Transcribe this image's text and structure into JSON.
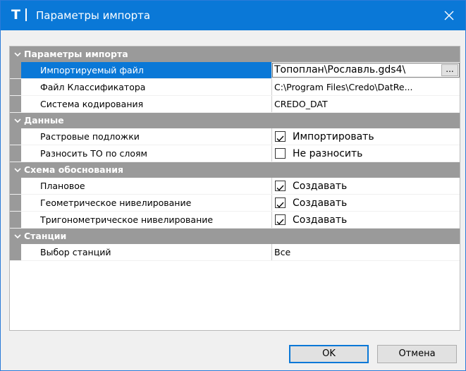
{
  "window": {
    "title": "Параметры импорта",
    "app_icon_letter": "T",
    "close_glyph": "✕"
  },
  "colors": {
    "titlebar": "#0a78d7",
    "category_bg": "#9a9a9a",
    "selection": "#0a78d7"
  },
  "grid": {
    "categories": [
      {
        "label": "Параметры импорта",
        "rows": [
          {
            "name": "Импортируемый файл",
            "value": "\\Топоплан\\Рославль.gds4",
            "selected": true,
            "browse": "..."
          },
          {
            "name": "Файл Классификатора",
            "value": "C:\\Program Files\\Credo\\DatRe..."
          },
          {
            "name": "Система кодирования",
            "value": "CREDO_DAT"
          }
        ]
      },
      {
        "label": "Данные",
        "rows": [
          {
            "name": "Растровые подложки",
            "value": "Импортировать",
            "checked": true
          },
          {
            "name": "Разносить ТО по слоям",
            "value": "Не разносить",
            "checked": false
          }
        ]
      },
      {
        "label": "Схема обоснования",
        "rows": [
          {
            "name": "Плановое",
            "value": "Создавать",
            "checked": true
          },
          {
            "name": "Геометрическое нивелирование",
            "value": "Создавать",
            "checked": true
          },
          {
            "name": "Тригонометрическое нивелирование",
            "value": "Создавать",
            "checked": true
          }
        ]
      },
      {
        "label": "Станции",
        "rows": [
          {
            "name": "Выбор станций",
            "value": "Все"
          }
        ]
      }
    ]
  },
  "buttons": {
    "ok": "OK",
    "cancel": "Отмена"
  }
}
